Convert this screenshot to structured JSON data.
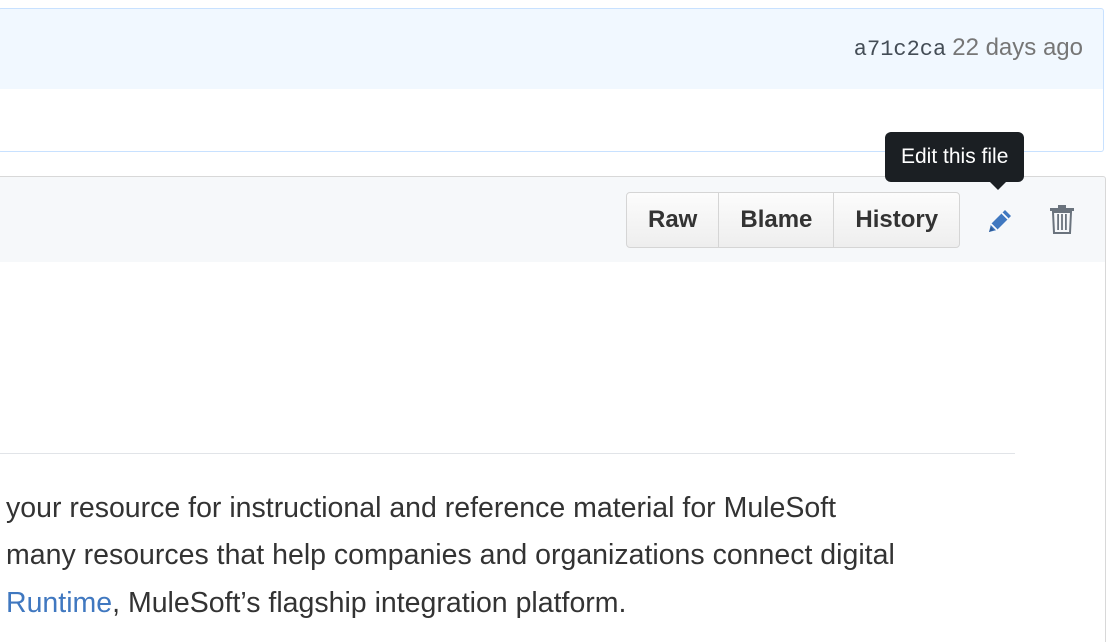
{
  "commit": {
    "sha": "a71c2ca",
    "age": "22 days ago"
  },
  "file_actions": {
    "raw_label": "Raw",
    "blame_label": "Blame",
    "history_label": "History",
    "edit_icon": "pencil-icon",
    "delete_icon": "trash-icon",
    "edit_tooltip": "Edit this file"
  },
  "readme": {
    "line1": "your resource for instructional and reference material for MuleSoft",
    "line2": "many resources that help companies and organizations connect digital",
    "line3_link": "Runtime",
    "line3_rest": ", MuleSoft’s flagship integration platform."
  },
  "colors": {
    "link": "#4078c0",
    "edit_icon": "#4078c0",
    "tooltip_bg": "#1b1f23",
    "commit_bg": "#f1f8ff"
  }
}
